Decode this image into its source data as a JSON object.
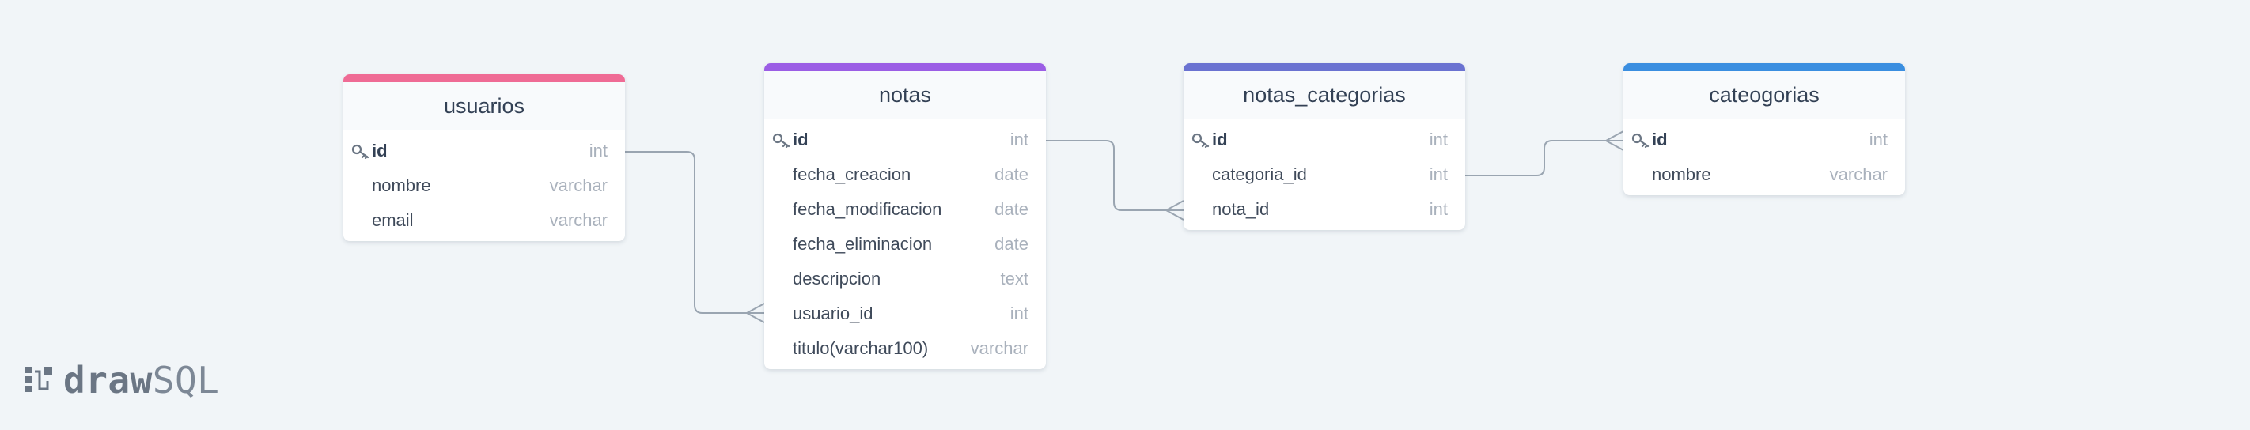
{
  "tables": {
    "usuarios": {
      "name": "usuarios",
      "color": "#ef6b95",
      "columns": [
        {
          "name": "id",
          "type": "int",
          "pk": true
        },
        {
          "name": "nombre",
          "type": "varchar",
          "pk": false
        },
        {
          "name": "email",
          "type": "varchar",
          "pk": false
        }
      ]
    },
    "notas": {
      "name": "notas",
      "color": "#9b5de5",
      "columns": [
        {
          "name": "id",
          "type": "int",
          "pk": true
        },
        {
          "name": "fecha_creacion",
          "type": "date",
          "pk": false
        },
        {
          "name": "fecha_modificacion",
          "type": "date",
          "pk": false
        },
        {
          "name": "fecha_eliminacion",
          "type": "date",
          "pk": false
        },
        {
          "name": "descripcion",
          "type": "text",
          "pk": false
        },
        {
          "name": "usuario_id",
          "type": "int",
          "pk": false
        },
        {
          "name": "titulo(varchar100)",
          "type": "varchar",
          "pk": false
        }
      ]
    },
    "notas_categorias": {
      "name": "notas_categorias",
      "color": "#6a72d1",
      "columns": [
        {
          "name": "id",
          "type": "int",
          "pk": true
        },
        {
          "name": "categoria_id",
          "type": "int",
          "pk": false
        },
        {
          "name": "nota_id",
          "type": "int",
          "pk": false
        }
      ]
    },
    "cateogorias": {
      "name": "cateogorias",
      "color": "#3a8ee0",
      "columns": [
        {
          "name": "id",
          "type": "int",
          "pk": true
        },
        {
          "name": "nombre",
          "type": "varchar",
          "pk": false
        }
      ]
    }
  },
  "relations": [
    {
      "from": "usuarios.id",
      "to": "notas.usuario_id"
    },
    {
      "from": "notas.id",
      "to": "notas_categorias.nota_id"
    },
    {
      "from": "notas_categorias.categoria_id",
      "to": "cateogorias.id"
    }
  ],
  "logo": {
    "bold": "draw",
    "light": "SQL"
  },
  "colors": {
    "line": "#9aa5b1",
    "key_icon": "#6b7684"
  }
}
